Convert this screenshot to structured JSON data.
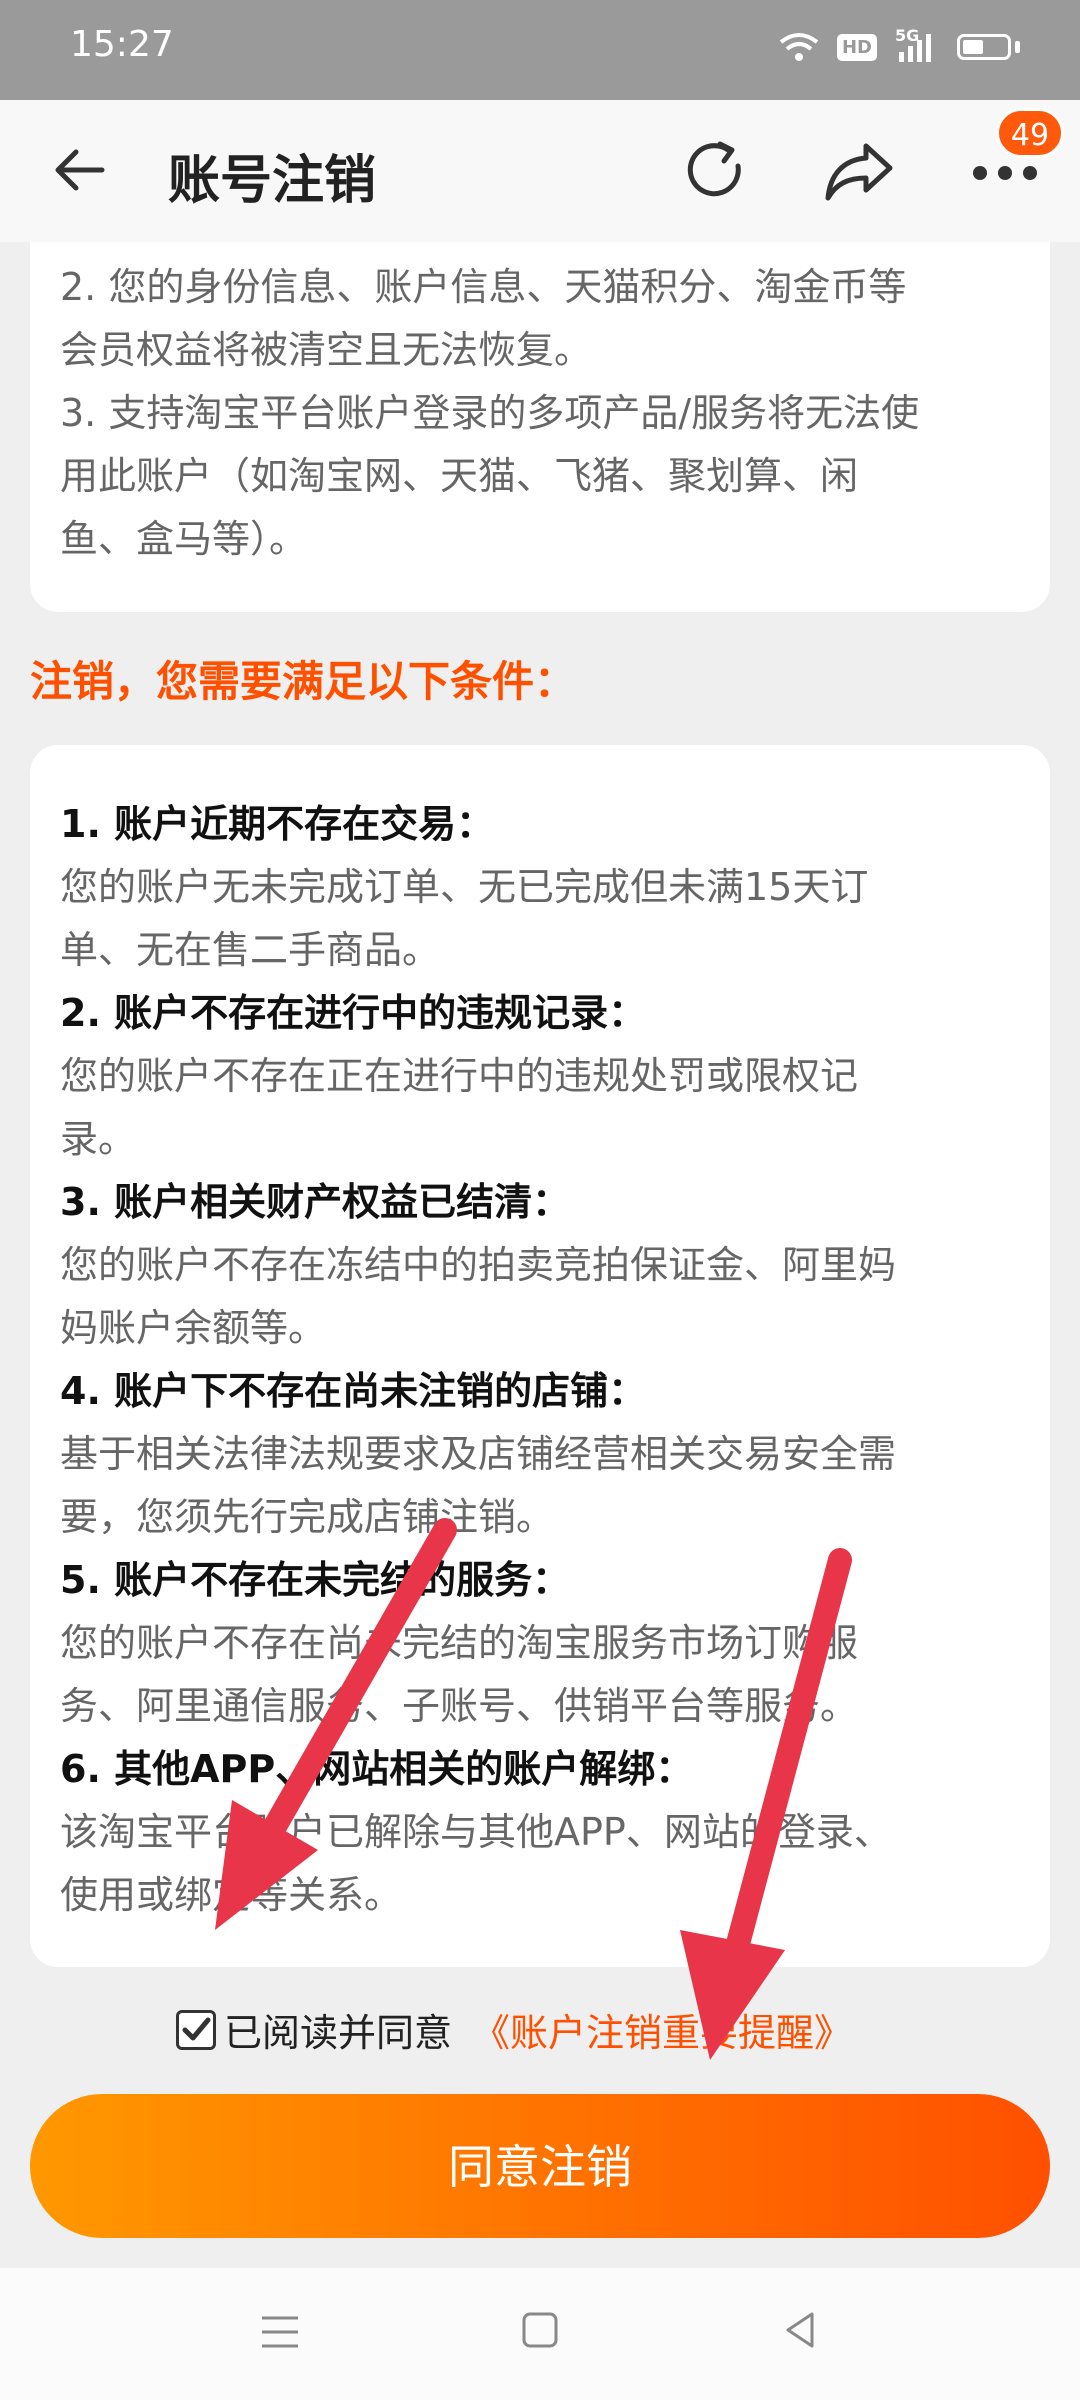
{
  "status": {
    "time": "15:27",
    "hd": "HD",
    "network": "5G"
  },
  "header": {
    "title": "账号注销",
    "badge_count": "49"
  },
  "top_card": {
    "lines": [
      "2. 您的身份信息、账户信息、天猫积分、淘金币等",
      "会员权益将被清空且无法恢复。",
      "3. 支持淘宝平台账户登录的多项产品/服务将无法使",
      "用此账户（如淘宝网、天猫、飞猪、聚划算、闲",
      "鱼、盒马等）。"
    ]
  },
  "section_title": "注销，您需要满足以下条件：",
  "conditions": [
    {
      "title": "1. 账户近期不存在交易：",
      "desc_lines": [
        "您的账户无未完成订单、无已完成但未满15天订",
        "单、无在售二手商品。"
      ]
    },
    {
      "title": "2. 账户不存在进行中的违规记录：",
      "desc_lines": [
        "您的账户不存在正在进行中的违规处罚或限权记",
        "录。"
      ]
    },
    {
      "title": "3. 账户相关财产权益已结清：",
      "desc_lines": [
        "您的账户不存在冻结中的拍卖竞拍保证金、阿里妈",
        "妈账户余额等。"
      ]
    },
    {
      "title": "4. 账户下不存在尚未注销的店铺：",
      "desc_lines": [
        "基于相关法律法规要求及店铺经营相关交易安全需",
        "要，您须先行完成店铺注销。"
      ]
    },
    {
      "title": "5. 账户不存在未完结的服务：",
      "desc_lines": [
        "您的账户不存在尚未完结的淘宝服务市场订购服",
        "务、阿里通信服务、子账号、供销平台等服务。"
      ]
    },
    {
      "title": "6. 其他APP、网站相关的账户解绑：",
      "desc_lines": [
        "该淘宝平台账户已解除与其他APP、网站的登录、",
        "使用或绑定等关系。"
      ]
    }
  ],
  "agreement": {
    "text": "已阅读并同意",
    "link": "《账户注销重要提醒》",
    "checked": true
  },
  "submit_label": "同意注销",
  "colors": {
    "accent": "#ff5000",
    "gradient_start": "#ff9800",
    "gradient_end": "#ff5000",
    "arrow": "#e8354a"
  },
  "icons": [
    "back-arrow-icon",
    "refresh-icon",
    "share-icon",
    "more-icon",
    "menu-icon",
    "home-icon",
    "back-triangle-icon",
    "checkmark-icon"
  ]
}
